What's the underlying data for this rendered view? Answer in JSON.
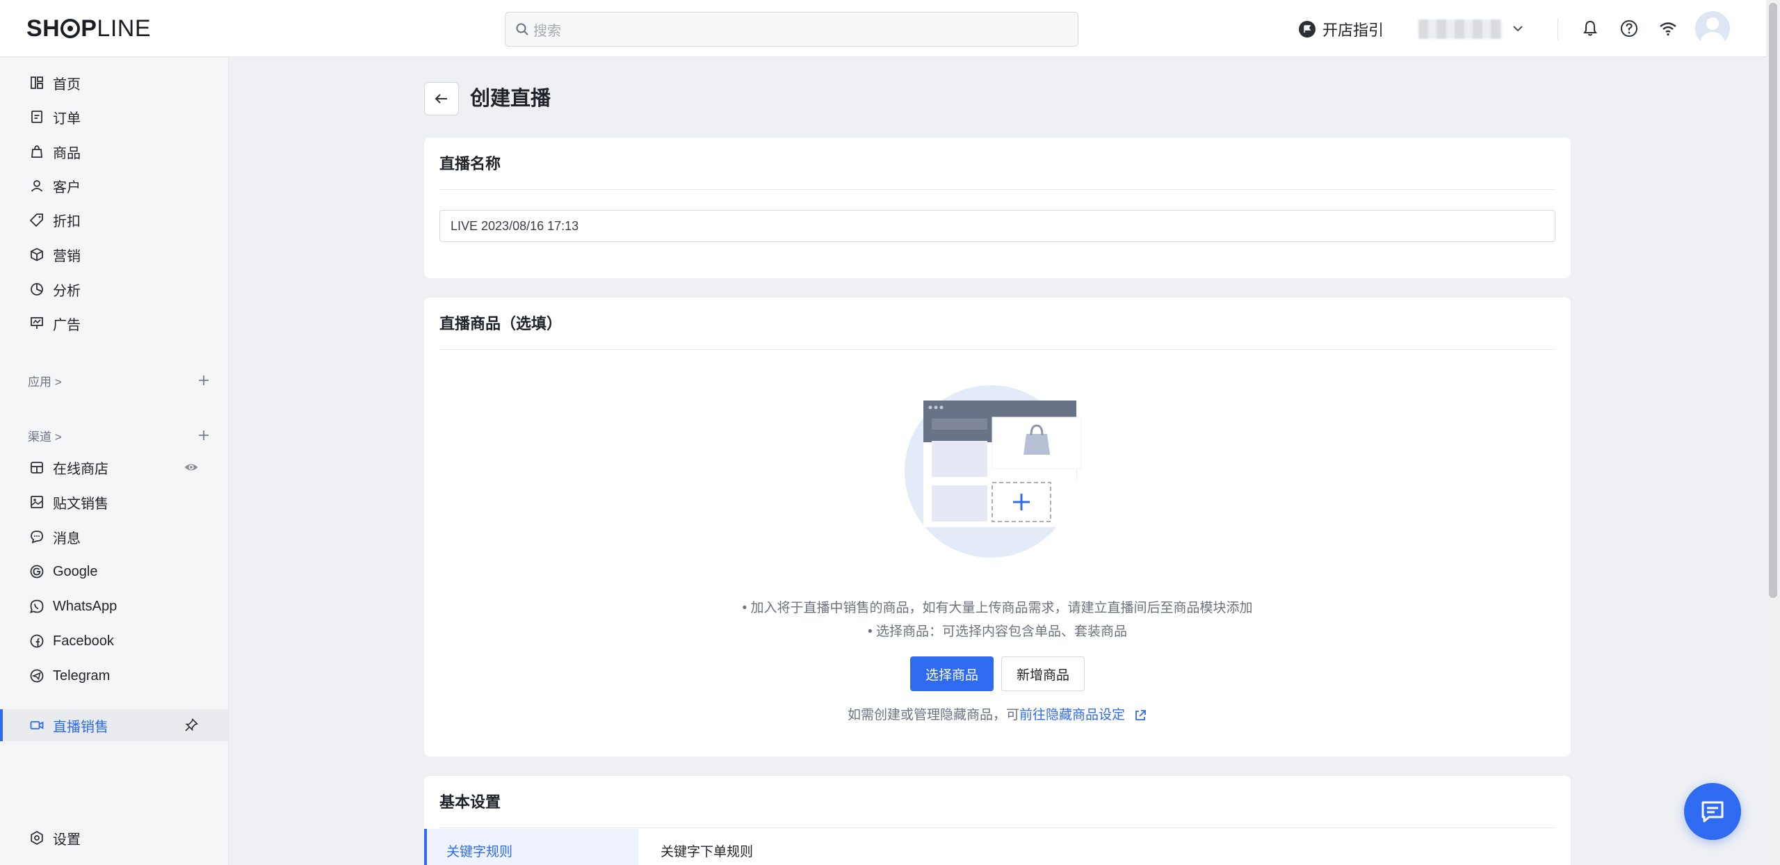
{
  "header": {
    "logo_bold": "SH",
    "logo_bold2": "P",
    "logo_light": "LINE",
    "search_placeholder": "搜索",
    "guide_label": "开店指引"
  },
  "sidebar": {
    "items": [
      {
        "label": "首页",
        "icon": "dashboard-icon"
      },
      {
        "label": "订单",
        "icon": "order-icon"
      },
      {
        "label": "商品",
        "icon": "bag-icon"
      },
      {
        "label": "客户",
        "icon": "user-icon"
      },
      {
        "label": "折扣",
        "icon": "tag-icon"
      },
      {
        "label": "营销",
        "icon": "cube-icon"
      },
      {
        "label": "分析",
        "icon": "pie-icon"
      },
      {
        "label": "广告",
        "icon": "ad-icon"
      }
    ],
    "apps_label": "应用 >",
    "channels_label": "渠道 >",
    "channels": [
      {
        "label": "在线商店",
        "icon": "store-icon"
      },
      {
        "label": "贴文销售",
        "icon": "post-icon"
      },
      {
        "label": "消息",
        "icon": "message-icon"
      },
      {
        "label": "Google",
        "icon": "google-icon"
      },
      {
        "label": "WhatsApp",
        "icon": "whatsapp-icon"
      },
      {
        "label": "Facebook",
        "icon": "facebook-icon"
      },
      {
        "label": "Telegram",
        "icon": "telegram-icon"
      }
    ],
    "active": {
      "label": "直播销售",
      "icon": "video-icon"
    },
    "settings": {
      "label": "设置",
      "icon": "settings-icon"
    }
  },
  "main": {
    "title": "创建直播",
    "name_card": {
      "title": "直播名称",
      "input_value": "LIVE 2023/08/16 17:13"
    },
    "products_card": {
      "title": "直播商品（选填）",
      "tip1": "• 加入将于直播中销售的商品，如有大量上传商品需求，请建立直播间后至商品模块添加",
      "tip2": "• 选择商品：可选择内容包含单品、套装商品",
      "select_button": "选择商品",
      "new_button": "新增商品",
      "hidden_note_prefix": "如需创建或管理隐藏商品，可",
      "hidden_note_link": "前往隐藏商品设定"
    },
    "basic_card": {
      "title": "基本设置",
      "tab": "关键字规则",
      "section_title": "关键字下单规则"
    }
  },
  "colors": {
    "primary": "#2f6bf0",
    "background": "#eef0f4"
  }
}
